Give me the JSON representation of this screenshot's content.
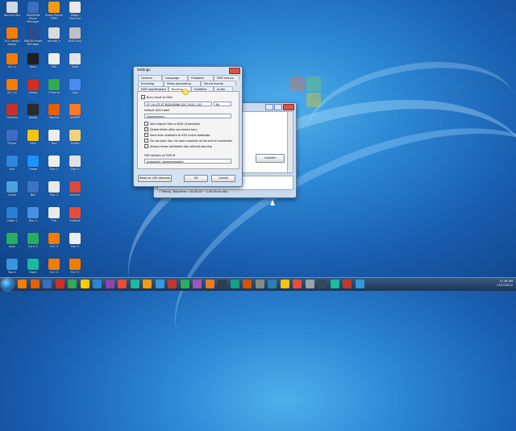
{
  "desktop": {
    "icons": [
      {
        "label": "Recycle Bin",
        "color": "#cfd8e3"
      },
      {
        "label": "IMGBURN Music Manager",
        "color": "#3a6fbf"
      },
      {
        "label": "Zoom Player FREE",
        "color": "#f39c12"
      },
      {
        "label": "Magic Shortcut",
        "color": "#e8e8e8"
      },
      {
        "label": "VLC media player",
        "color": "#f57c00"
      },
      {
        "label": "MAGIX Photo Manager",
        "color": "#2d4c8c"
      },
      {
        "label": "remote_x",
        "color": "#d9d9d9"
      },
      {
        "label": "DVD Flick",
        "color": "#c0c0c0"
      },
      {
        "label": "VLC x",
        "color": "#f57c00"
      },
      {
        "label": "Nero",
        "color": "#1f1f1f"
      },
      {
        "label": "PDF",
        "color": "#eeeeee"
      },
      {
        "label": "Data",
        "color": "#e3e3e3"
      },
      {
        "label": "VLC x2",
        "color": "#f57c00"
      },
      {
        "label": "Opera",
        "color": "#d62d20"
      },
      {
        "label": "Chrome",
        "color": "#34a853"
      },
      {
        "label": "App",
        "color": "#4c8bf5"
      },
      {
        "label": "FileZilla",
        "color": "#c9302c"
      },
      {
        "label": "Media",
        "color": "#2b2b2b"
      },
      {
        "label": "Mozilla",
        "color": "#e66000"
      },
      {
        "label": "XAMPP",
        "color": "#fb7a24"
      },
      {
        "label": "Player",
        "color": "#3d6cc2"
      },
      {
        "label": "Disc",
        "color": "#f1c40f"
      },
      {
        "label": "Doc",
        "color": "#ececec"
      },
      {
        "label": "Folder",
        "color": "#f0d27a"
      },
      {
        "label": "Tool",
        "color": "#2e86de"
      },
      {
        "label": "Globe",
        "color": "#1e90ff"
      },
      {
        "label": "Doc 2",
        "color": "#ededed"
      },
      {
        "label": "Doc 3",
        "color": "#e0e0e0"
      },
      {
        "label": "Snow",
        "color": "#4aa3df"
      },
      {
        "label": "Ball",
        "color": "#3a75c4"
      },
      {
        "label": "Doc 4",
        "color": "#e8e8e8"
      },
      {
        "label": "Archive",
        "color": "#d84a3a"
      },
      {
        "label": "Globe 2",
        "color": "#2a7fd6"
      },
      {
        "label": "Disc 2",
        "color": "#4a90e2"
      },
      {
        "label": "File",
        "color": "#e9e9e9"
      },
      {
        "label": "Subtitle",
        "color": "#e74c3c"
      },
      {
        "label": "Sync",
        "color": "#27ae60"
      },
      {
        "label": "Sync 2",
        "color": "#27ae60"
      },
      {
        "label": "VLC 3",
        "color": "#f57c00"
      },
      {
        "label": "Doc 5",
        "color": "#ececec"
      },
      {
        "label": "Tool 2",
        "color": "#3498db"
      },
      {
        "label": "Store",
        "color": "#1abc9c"
      },
      {
        "label": "VLC 4",
        "color": "#f57c00"
      },
      {
        "label": "VLC 5",
        "color": "#f57c00"
      }
    ]
  },
  "bg_window": {
    "button_convert": "Convert",
    "log_line": "1 Title(s), Total time = 01:30:43 ~ 1.90 Gb on disc"
  },
  "settings": {
    "title": "Settings",
    "tabs_row1": [
      "General",
      "Language",
      "Chapters",
      "DVD menus"
    ],
    "tabs_row2": [
      "Encoding",
      "Video processing",
      "Sound events"
    ],
    "tabs_row3": [
      "DVD specification",
      "Burning",
      "Subtitles",
      "Audio"
    ],
    "burn_to_dvd": "Burn result to DVD",
    "drive": "[F:] HL-DT-ST BDDVDRW GGC-H20L 1.03",
    "speed": "8x",
    "label_caption": "Default DVD Label",
    "label_value": "Dogmonkeys",
    "options": [
      {
        "text": "Add original files to DVD (if possible)",
        "checked": false
      },
      {
        "text": "Delete folder after successful burn",
        "checked": true
      },
      {
        "text": "Send burn statistics to VSO online database",
        "checked": true
      },
      {
        "text": "Do not eject disc nor open explorer at the end of conversion",
        "checked": false
      },
      {
        "text": "Always erase rewritable disc without warning",
        "checked": false
      }
    ],
    "sao_caption": "SAO options on DVD-R",
    "sao_value": "Automatic (recommended)",
    "reset_btn": "Reset to VSO defaults",
    "ok_btn": "OK",
    "cancel_btn": "Cancel"
  },
  "taskbar": {
    "time": "11:38 AM",
    "date": "11/17/2012",
    "colors": [
      "#f57c00",
      "#e66000",
      "#3d6cc2",
      "#d62d20",
      "#34a853",
      "#ffcc00",
      "#2b86d4",
      "#8e44ad",
      "#e74c3c",
      "#1abc9c",
      "#f39c12",
      "#3498db",
      "#c0392b",
      "#27ae60",
      "#9b59b6",
      "#e67e22",
      "#2c3e50",
      "#16a085",
      "#d35400",
      "#7f8c8d",
      "#2980b9",
      "#f1c40f",
      "#e74c3c",
      "#95a5a6",
      "#34495e",
      "#1abc9c",
      "#c0392b",
      "#3498db"
    ]
  }
}
